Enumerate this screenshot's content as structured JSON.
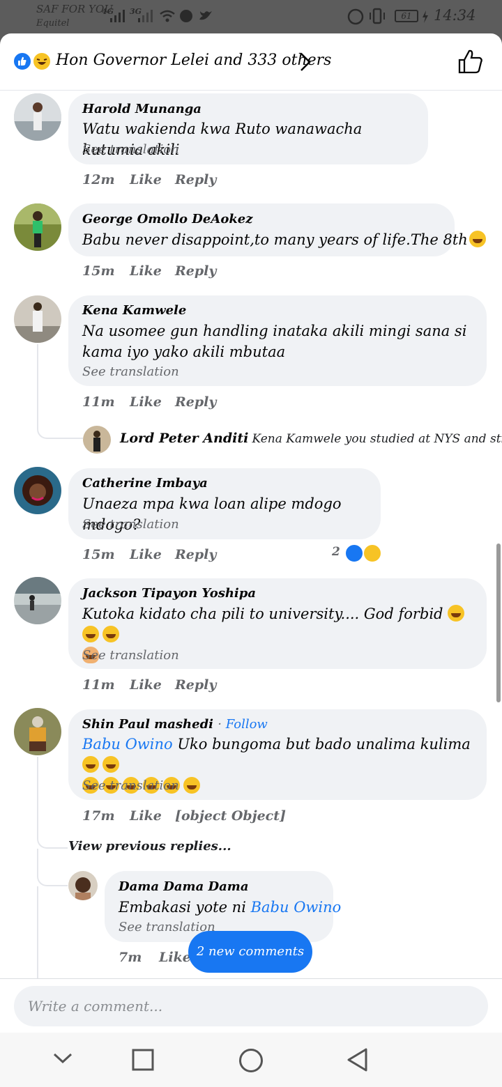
{
  "status_bar": {
    "carrier": "SAF FOR YOU",
    "carrier_secondary": "Equitel",
    "signal_labels": [
      "4G",
      "3G"
    ],
    "battery": "61",
    "time": "14:34"
  },
  "header": {
    "reactions_text": "Hon Governor Lelei and 333 others",
    "reaction_icons": [
      "like-icon",
      "haha-icon"
    ]
  },
  "comments": [
    {
      "author": "Harold Munanga",
      "text": "Watu wakienda kwa Ruto wanawacha kutumia akili",
      "see_translation": "See translation",
      "time": "12m",
      "like": "Like",
      "reply": "Reply"
    },
    {
      "author": "George Omollo DeAokez",
      "text": "Babu never disappoint,to many years of life.The 8th",
      "time": "15m",
      "like": "Like",
      "reply": "Reply"
    },
    {
      "author": "Kena Kamwele",
      "text": "Na usomee gun handling inataka akili mingi sana si kama iyo yako akili mbutaa",
      "see_translation": "See translation",
      "time": "11m",
      "like": "Like",
      "reply": "Reply",
      "reply_preview": {
        "author": "Lord Peter Anditi",
        "text": "Kena Kamwele you studied at NYS and still argui..."
      }
    },
    {
      "author": "Catherine Imbaya",
      "text": "Unaeza mpa kwa loan alipe mdogo mdogo?",
      "see_translation": "See translation",
      "time": "15m",
      "like": "Like",
      "reply": "Reply",
      "reaction_count": "2"
    },
    {
      "author": "Jackson Tipayon Yoshipa",
      "text": "Kutoka kidato cha pili to university.... God forbid",
      "see_translation": "See translation",
      "time": "11m",
      "like": "Like",
      "reply": "Reply"
    },
    {
      "author": "Shin Paul mashedi",
      "follow": "Follow",
      "mention": "Babu Owino",
      "text": " Uko bungoma but bado unalima kulima",
      "see_translation": "See translation",
      "time": "17m",
      "like": "Like",
      "reply": {
        "author": "Dama Dama Dama",
        "text": "Embakasi yote ni ",
        "mention": "Babu Owino",
        "see_translation": "See translation",
        "time": "7m",
        "like": "Like"
      },
      "view_previous": "View previous replies..."
    }
  ],
  "new_comments_button": "2 new comments",
  "composer": {
    "placeholder": "Write a comment..."
  },
  "nav": [
    "chevron-down-icon",
    "square-icon",
    "circle-icon",
    "back-triangle-icon"
  ]
}
